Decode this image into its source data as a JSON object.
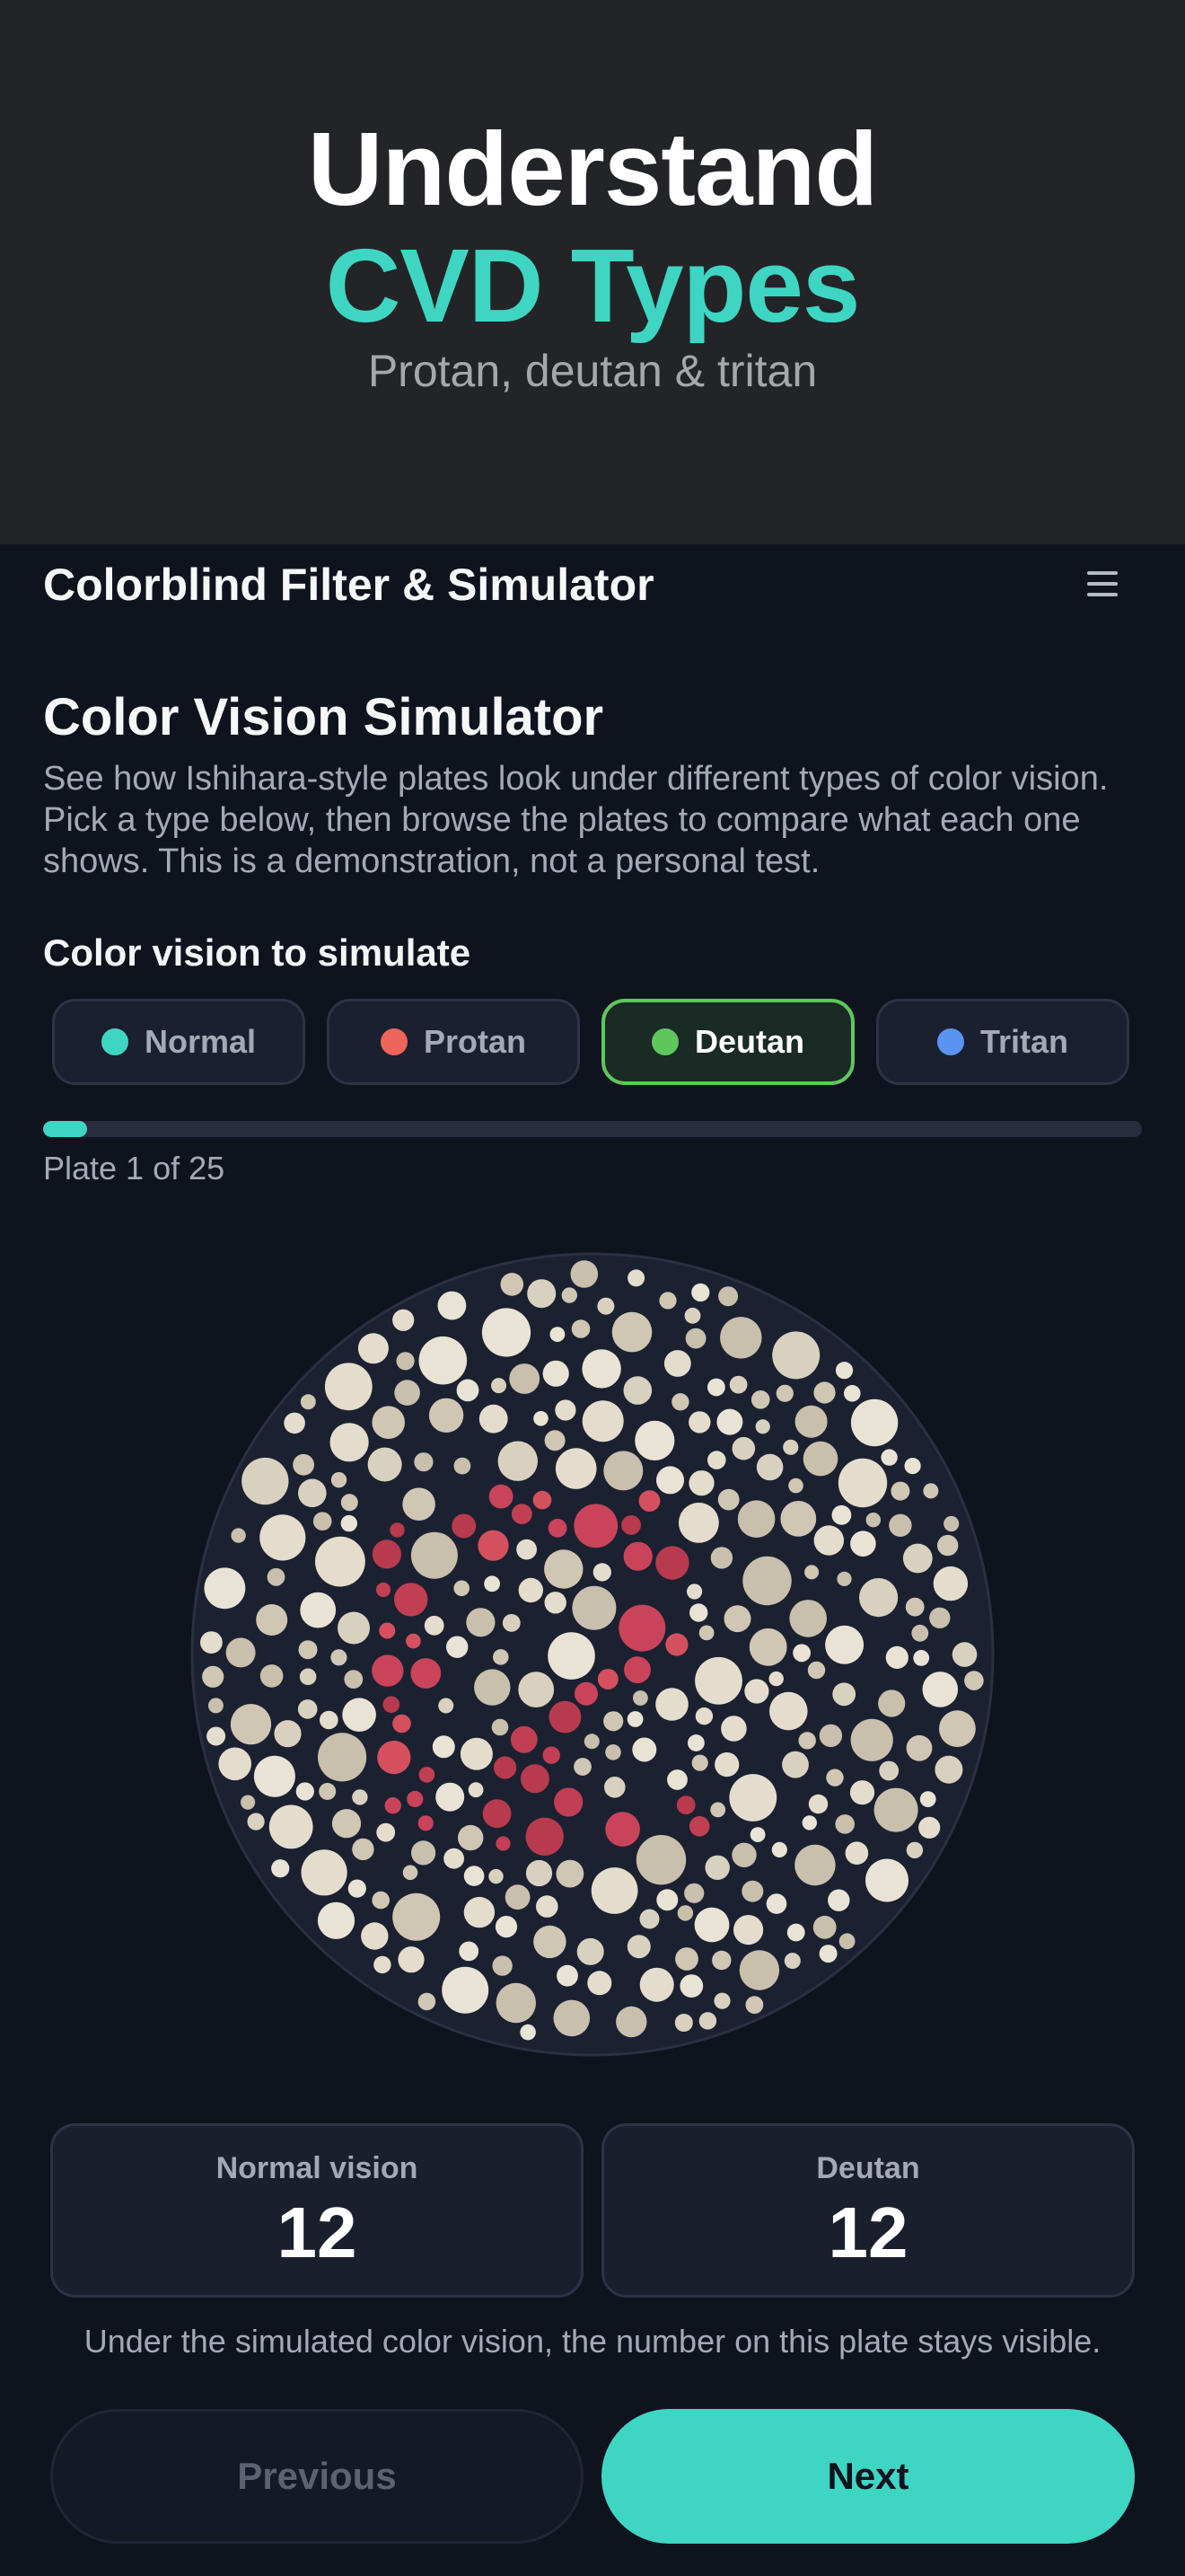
{
  "hero": {
    "title_line1": "Understand",
    "title_line2": "CVD Types",
    "subtitle": "Protan, deutan & tritan",
    "accent_color": "#3ed6c3"
  },
  "app": {
    "title": "Colorblind Filter & Simulator",
    "menu_icon": "hamburger-menu-icon"
  },
  "simulator": {
    "title": "Color Vision Simulator",
    "description": "See how Ishihara-style plates look under different types of color vision. Pick a type below, then browse the plates to compare what each one shows. This is a demonstration, not a personal test.",
    "section_label": "Color vision to simulate",
    "types": [
      {
        "label": "Normal",
        "color": "#3ed6c3",
        "selected": false
      },
      {
        "label": "Protan",
        "color": "#f0655a",
        "selected": false
      },
      {
        "label": "Deutan",
        "color": "#5ec75c",
        "selected": true
      },
      {
        "label": "Tritan",
        "color": "#5b93f0",
        "selected": false
      }
    ]
  },
  "progress": {
    "current": 1,
    "total": 25,
    "fraction": 0.04,
    "text": "Plate 1 of 25"
  },
  "plate": {
    "background_color": "#1c2131",
    "dot_color": "#dcd4c4",
    "figure_color": "#c9445a"
  },
  "results": {
    "normal_label": "Normal vision",
    "normal_value": "12",
    "simulated_label": "Deutan",
    "simulated_value": "12",
    "note": "Under the simulated color vision, the number on this plate stays visible."
  },
  "nav": {
    "prev_label": "Previous",
    "next_label": "Next"
  }
}
